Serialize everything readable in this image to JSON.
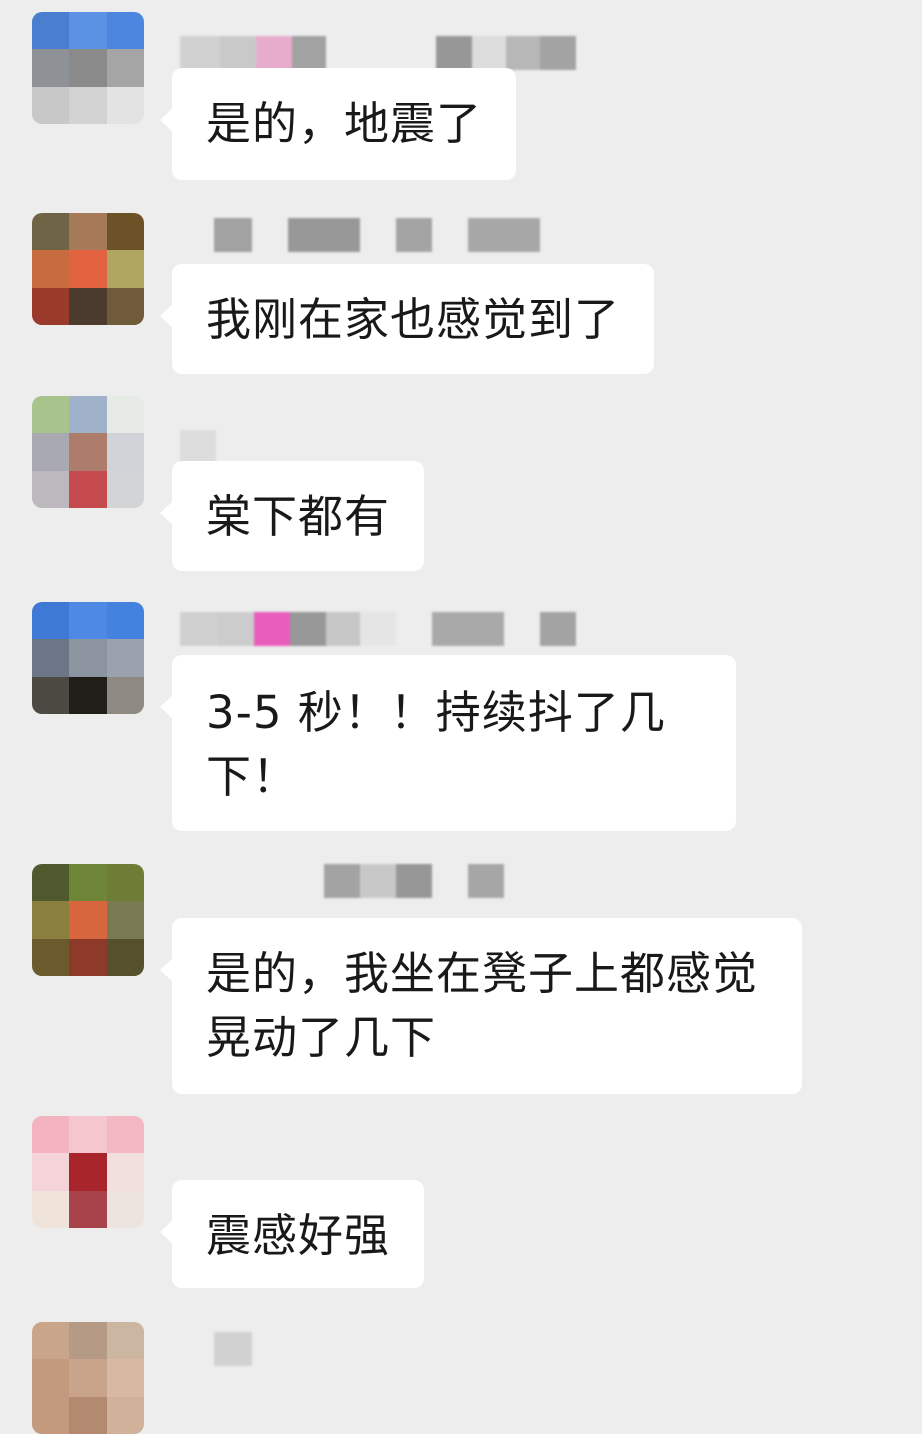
{
  "messages": [
    {
      "text": "是的，地震了"
    },
    {
      "text": "我刚在家也感觉到了"
    },
    {
      "text": "棠下都有"
    },
    {
      "text": "3-5 秒！！持续抖了几下！"
    },
    {
      "text": "是的，我坐在凳子上都感觉晃动了几下"
    },
    {
      "text": "震感好强"
    }
  ],
  "colors": {
    "background": "#ededed",
    "bubble": "#ffffff",
    "text": "#191919"
  }
}
